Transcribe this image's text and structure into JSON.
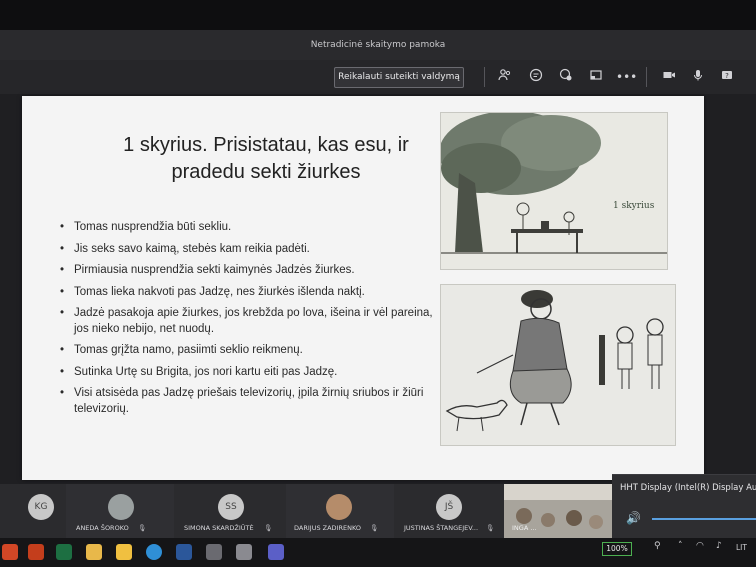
{
  "window": {
    "title": "Netradicinė skaitymo pamoka"
  },
  "toolbar": {
    "control_button": "Reikalauti suteikti valdymą",
    "icons": [
      "people-icon",
      "chat-icon",
      "reactions-icon",
      "share-icon",
      "more-icon",
      "camera-icon",
      "mic-icon",
      "help-icon"
    ]
  },
  "slide": {
    "title_line1": "1 skyrius. Prisistatau, kas esu, ir",
    "title_line2": "pradedu sekti žiurkes",
    "bullets": [
      "Tomas nusprendžia būti sekliu.",
      "Jis seks savo kaimą, stebės kam reikia padėti.",
      "Pirmiausia nusprendžia sekti kaimynės Jadzės žiurkes.",
      "Tomas lieka nakvoti pas Jadzę, nes žiurkės išlenda naktį.",
      "Jadzė pasakoja apie žiurkes, jos krebžda po lova, išeina ir vėl pareina, jos nieko nebijo, net nuodų.",
      "Tomas grįžta namo, pasiimti seklio reikmenų.",
      "Sutinka Urtę su Brigita, jos nori kartu eiti pas Jadzę.",
      "Visi atsisėda pas Jadzę priešais televizorių, įpila žirnių sriubos ir žiūri televizorių."
    ],
    "illustration1_caption": "1 skyrius"
  },
  "participants": [
    {
      "initials": "KG",
      "name": ""
    },
    {
      "initials": "",
      "name": "ANEDA ŠOROKO"
    },
    {
      "initials": "SS",
      "name": "SIMONA SKARDŽIŪTĖ"
    },
    {
      "initials": "",
      "name": "DARIJUS ZADIRENKO"
    },
    {
      "initials": "JŠ",
      "name": "JUSTINAS ŠTANGEJEV..."
    },
    {
      "initials": "",
      "name": "INGA ..."
    }
  ],
  "volume": {
    "device": "HHT Display (Intel(R) Display Audio"
  },
  "taskbar": {
    "battery": "100%",
    "language": "LIT"
  },
  "colors": {
    "accent": "#5aa0e0",
    "battery": "#4caf50"
  }
}
